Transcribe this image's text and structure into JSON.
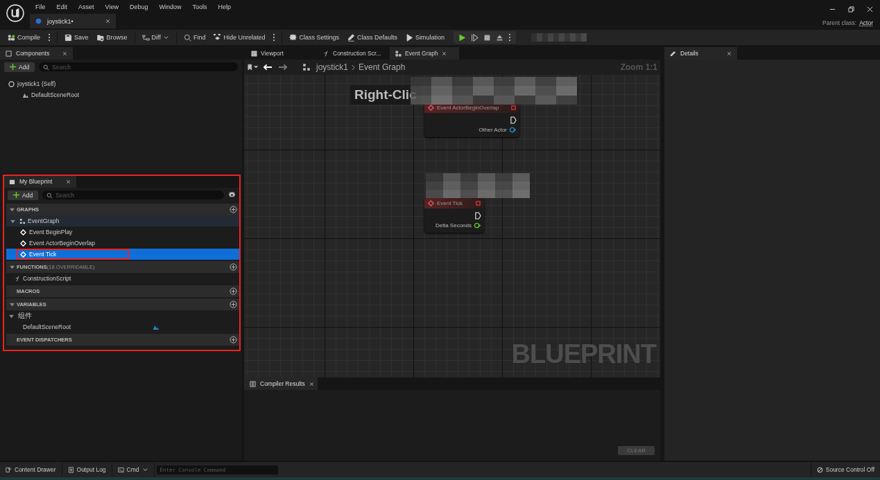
{
  "menu": [
    "File",
    "Edit",
    "Asset",
    "View",
    "Debug",
    "Window",
    "Tools",
    "Help"
  ],
  "document_tabs": [
    {
      "label": "joystick1•",
      "selected": true
    }
  ],
  "parent_class": {
    "label": "Parent class:",
    "value": "Actor"
  },
  "toolbar": [
    {
      "label": "Compile",
      "more": true
    },
    {
      "label": "Save",
      "more": false
    },
    {
      "label": "Browse",
      "more": false
    },
    {
      "label": "Diff",
      "dropdown": true,
      "more": false
    },
    {
      "label": "Find",
      "more": false
    },
    {
      "label": "Hide Unrelated",
      "more": true
    },
    {
      "label": "Class Settings",
      "more": false
    },
    {
      "label": "Class Defaults",
      "more": false
    },
    {
      "label": "Simulation",
      "more": false
    }
  ],
  "components": {
    "tab": "Components",
    "add": "Add",
    "search": {
      "placeholder": "Search"
    },
    "tree": [
      {
        "label": "joystick1 (Self)",
        "children": [
          {
            "label": "DefaultSceneRoot"
          }
        ]
      }
    ]
  },
  "my_blueprint": {
    "tab": "My Blueprint",
    "outlined": true,
    "add": "Add",
    "search": {
      "placeholder": "Search"
    },
    "sections": [
      {
        "title": "GRAPHS",
        "expanded": true,
        "rows": [
          {
            "label": "EventGraph",
            "kind": "graph",
            "expanded": true,
            "children": [
              {
                "label": "Event BeginPlay",
                "selected": false,
                "outlined": false
              },
              {
                "label": "Event ActorBeginOverlap",
                "selected": false,
                "outlined": false
              },
              {
                "label": "Event Tick",
                "selected": true,
                "outlined": true
              }
            ]
          }
        ]
      },
      {
        "title": "FUNCTIONS",
        "note": "(18 OVERRIDABLE)",
        "expanded": true,
        "rows": [
          {
            "label": "ConstructionScript",
            "kind": "function"
          }
        ]
      },
      {
        "title": "MACROS",
        "expanded": false
      },
      {
        "title": "VARIABLES",
        "expanded": true,
        "rows": [
          {
            "label": "组件",
            "kind": "category",
            "expanded": true,
            "children": [
              {
                "label": "DefaultSceneRoot",
                "kind": "variable"
              }
            ]
          }
        ]
      },
      {
        "title": "EVENT DISPATCHERS",
        "expanded": false
      }
    ]
  },
  "editor_tabs": [
    {
      "label": "Viewport",
      "selected": false
    },
    {
      "label": "Construction Scr...",
      "selected": false
    },
    {
      "label": "Event Graph",
      "selected": true
    }
  ],
  "breadcrumb": {
    "items": [
      "joystick1",
      "Event Graph"
    ],
    "zoom": "Zoom 1:1"
  },
  "graph": {
    "hint": "Right-Clic",
    "watermark": "BLUEPRINT",
    "nodes": [
      {
        "title": "Event ActorBeginOverlap",
        "pin": {
          "label": "Other Actor",
          "color": "#1f8fd0"
        }
      },
      {
        "title": "Event Tick",
        "pin": {
          "label": "Delta Seconds",
          "color": "#5cc81e"
        }
      }
    ]
  },
  "compiler_results": {
    "tab": "Compiler Results",
    "clear": "CLEAR"
  },
  "details": {
    "tab": "Details"
  },
  "status_bar": {
    "content_drawer": "Content Drawer",
    "output_log": "Output Log",
    "cmd": "Cmd",
    "console": {
      "placeholder": "Enter Console Command"
    },
    "source_control": "Source Control Off"
  }
}
